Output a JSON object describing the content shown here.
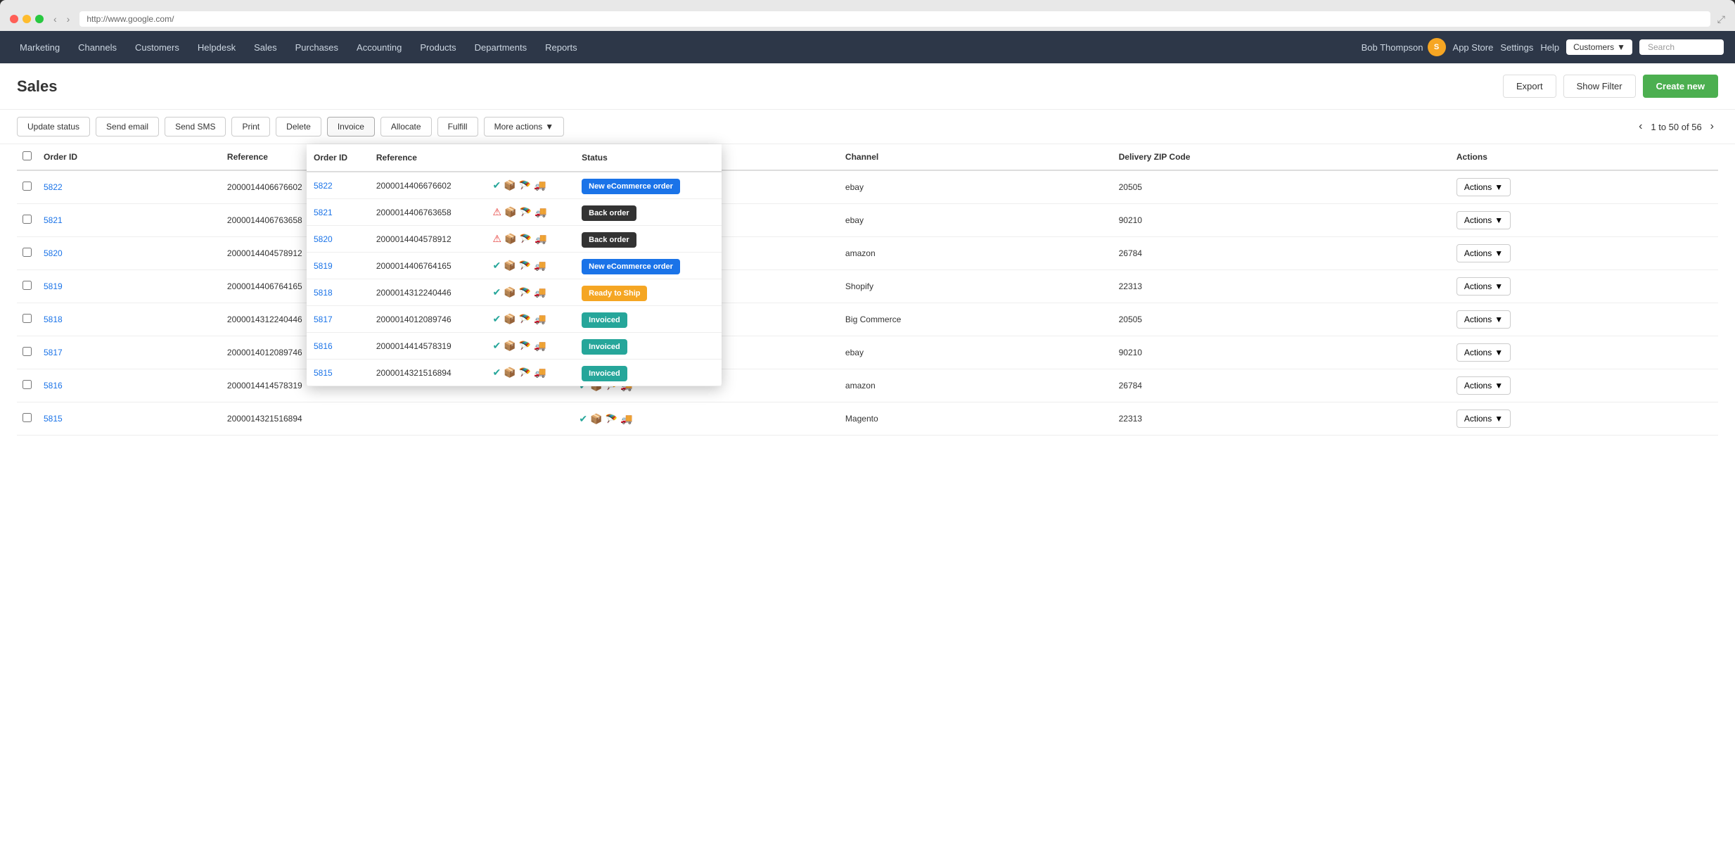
{
  "browser": {
    "url": "http://www.google.com/",
    "nav_back": "‹",
    "nav_forward": "›",
    "expand": "⤢"
  },
  "nav": {
    "items": [
      {
        "label": "Marketing",
        "id": "marketing"
      },
      {
        "label": "Channels",
        "id": "channels"
      },
      {
        "label": "Customers",
        "id": "customers"
      },
      {
        "label": "Helpdesk",
        "id": "helpdesk"
      },
      {
        "label": "Sales",
        "id": "sales"
      },
      {
        "label": "Purchases",
        "id": "purchases"
      },
      {
        "label": "Accounting",
        "id": "accounting"
      },
      {
        "label": "Products",
        "id": "products"
      },
      {
        "label": "Departments",
        "id": "departments"
      },
      {
        "label": "Reports",
        "id": "reports"
      }
    ],
    "user": "Bob Thompson",
    "app_store": "App Store",
    "settings": "Settings",
    "help": "Help",
    "customer_dropdown": "Customers",
    "search_placeholder": "Search"
  },
  "page": {
    "title": "Sales",
    "export_label": "Export",
    "show_filter_label": "Show Filter",
    "create_new_label": "Create new"
  },
  "toolbar": {
    "update_status": "Update status",
    "send_email": "Send email",
    "send_sms": "Send SMS",
    "print": "Print",
    "delete": "Delete",
    "invoice": "Invoice",
    "allocate": "Allocate",
    "fulfill": "Fulfill",
    "more_actions": "More actions",
    "pagination_text": "1 to 50 of 56",
    "prev": "‹",
    "next": "›"
  },
  "table": {
    "columns": [
      "Order ID",
      "Reference",
      "",
      "Channel",
      "Delivery ZIP Code",
      "Actions"
    ],
    "rows": [
      {
        "id": "5822",
        "reference": "2000014406676602",
        "channel": "ebay",
        "zip": "20505",
        "status": "ok",
        "actions": "Actions"
      },
      {
        "id": "5821",
        "reference": "2000014406763658",
        "channel": "ebay",
        "zip": "90210",
        "status": "error",
        "actions": "Actions"
      },
      {
        "id": "5820",
        "reference": "2000014404578912",
        "channel": "amazon",
        "zip": "26784",
        "status": "error",
        "actions": "Actions"
      },
      {
        "id": "5819",
        "reference": "2000014406764165",
        "channel": "Shopify",
        "zip": "22313",
        "status": "ok",
        "actions": "Actions"
      },
      {
        "id": "5818",
        "reference": "2000014312240446",
        "channel": "Big Commerce",
        "zip": "20505",
        "status": "ok-special",
        "actions": "Actions"
      },
      {
        "id": "5817",
        "reference": "2000014012089746",
        "channel": "ebay",
        "zip": "90210",
        "status": "ok-teal",
        "actions": "Actions"
      },
      {
        "id": "5816",
        "reference": "2000014414578319",
        "channel": "amazon",
        "zip": "26784",
        "status": "ok-teal",
        "actions": "Actions"
      },
      {
        "id": "5815",
        "reference": "2000014321516894",
        "channel": "Magento",
        "zip": "22313",
        "status": "ok-teal",
        "actions": "Actions"
      }
    ]
  },
  "overlay": {
    "columns": [
      "Order ID",
      "Reference",
      "Status"
    ],
    "rows": [
      {
        "id": "5822",
        "reference": "2000014406676602",
        "status_label": "New eCommerce order",
        "status_type": "new-ecommerce",
        "status_icons": "ok"
      },
      {
        "id": "5821",
        "reference": "2000014406763658",
        "status_label": "Back order",
        "status_type": "backorder",
        "status_icons": "error"
      },
      {
        "id": "5820",
        "reference": "2000014404578912",
        "status_label": "Back order",
        "status_type": "backorder",
        "status_icons": "error"
      },
      {
        "id": "5819",
        "reference": "2000014406764165",
        "status_label": "New eCommerce order",
        "status_type": "new-ecommerce",
        "status_icons": "ok"
      },
      {
        "id": "5818",
        "reference": "2000014312240446",
        "status_label": "Ready to Ship",
        "status_type": "ready",
        "status_icons": "ok-special"
      },
      {
        "id": "5817",
        "reference": "2000014012089746",
        "status_label": "Invoiced",
        "status_type": "invoiced",
        "status_icons": "ok-teal"
      },
      {
        "id": "5816",
        "reference": "2000014414578319",
        "status_label": "Invoiced",
        "status_type": "invoiced",
        "status_icons": "ok-teal"
      },
      {
        "id": "5815",
        "reference": "2000014321516894",
        "status_label": "Invoiced",
        "status_type": "invoiced",
        "status_icons": "ok-teal"
      }
    ]
  },
  "colors": {
    "nav_bg": "#2d3748",
    "primary_green": "#4caf50",
    "teal": "#26a69a",
    "blue_link": "#1a73e8",
    "badge_blue": "#1a73e8",
    "badge_dark": "#333333",
    "badge_orange": "#f5a623",
    "badge_teal": "#26a69a"
  }
}
